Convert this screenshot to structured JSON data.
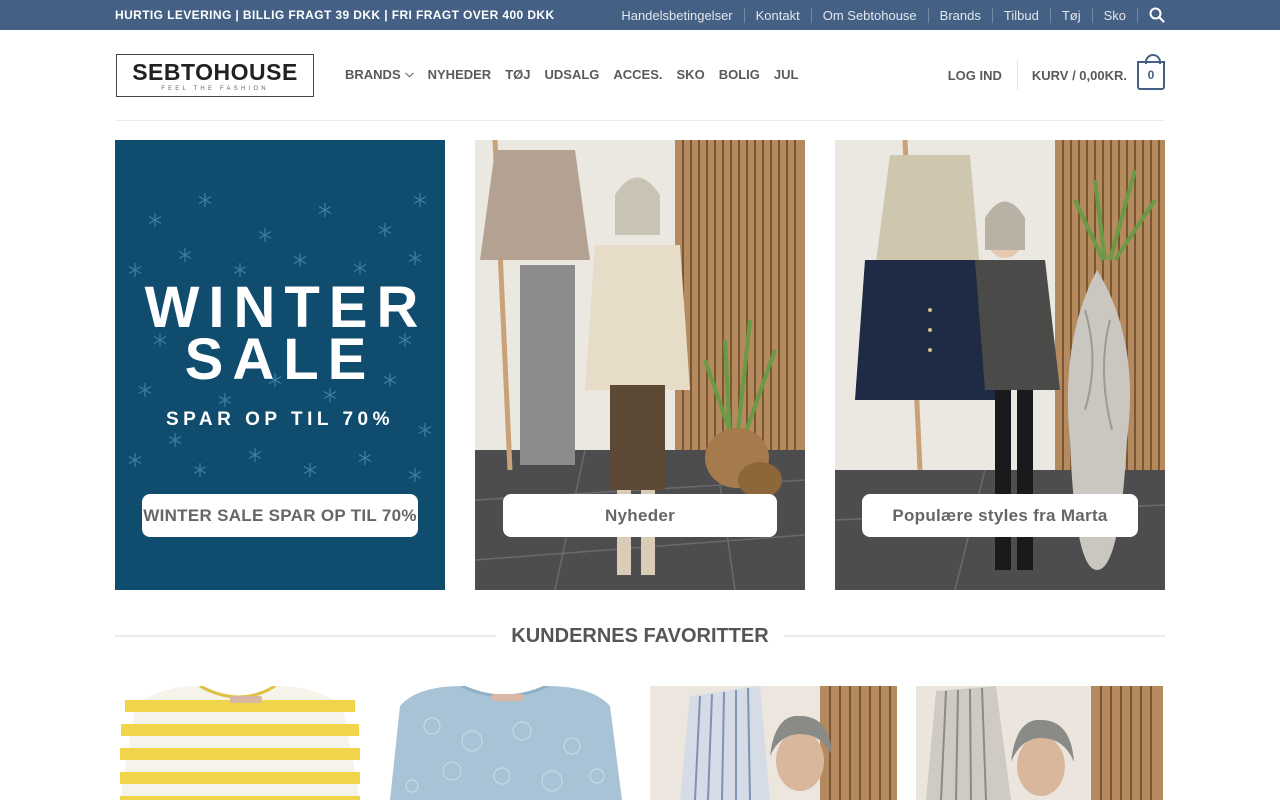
{
  "topbar": {
    "promo": "HURTIG LEVERING | BILLIG FRAGT 39 DKK | FRI FRAGT OVER 400 DKK",
    "links": [
      "Handelsbetingelser",
      "Kontakt",
      "Om Sebtohouse",
      "Brands",
      "Tilbud",
      "Tøj",
      "Sko"
    ],
    "search_icon": "search-icon",
    "background": "#446084"
  },
  "header": {
    "logo_text": "SEBTOHOUSE",
    "logo_tagline": "FEEL THE FASHION",
    "nav": [
      "BRANDS",
      "NYHEDER",
      "TØJ",
      "UDSALG",
      "ACCES.",
      "SKO",
      "BOLIG",
      "JUL"
    ],
    "nav_dropdown_icon": "chevron-down-icon",
    "login": "LOG IND",
    "cart_label": "KURV / 0,00KR.",
    "cart_count": "0",
    "accent": "#446084"
  },
  "banners": [
    {
      "heading_line1": "WINTER",
      "heading_line2": "SALE",
      "subheading": "SPAR OP TIL 70%",
      "button": "WINTER SALE SPAR OP TIL 70%",
      "background": "#0f4c6e"
    },
    {
      "button": "Nyheder"
    },
    {
      "button": "Populære styles fra Marta"
    }
  ],
  "section": {
    "title": "KUNDERNES FAVORITTER"
  }
}
